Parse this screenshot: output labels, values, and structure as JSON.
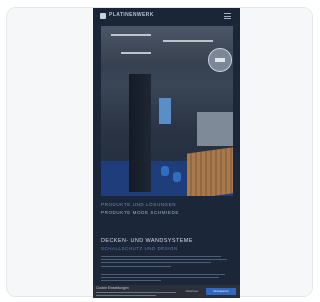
{
  "header": {
    "brand": "PLATINENWERK",
    "menu_icon": "hamburger-menu-icon",
    "logo_icon": "brand-logo-icon"
  },
  "hero": {
    "badge_icon": "circular-badge-icon"
  },
  "section1": {
    "eyebrow": "PRODUKTE UND LÖSUNGEN",
    "subhead": "PRODUKTE MODE SCHMIEDE"
  },
  "section2": {
    "title": "DECKEN- UND WANDSYSTEME",
    "subtitle": "SCHALLSCHUTZ UND DESIGN"
  },
  "cookie": {
    "title": "Cookie Einstellungen",
    "decline_label": "Ablehnen",
    "accept_label": "Akzeptieren"
  },
  "colors": {
    "background": "#1b2638",
    "accent": "#2f67c4",
    "floor": "#1e3d7a"
  }
}
